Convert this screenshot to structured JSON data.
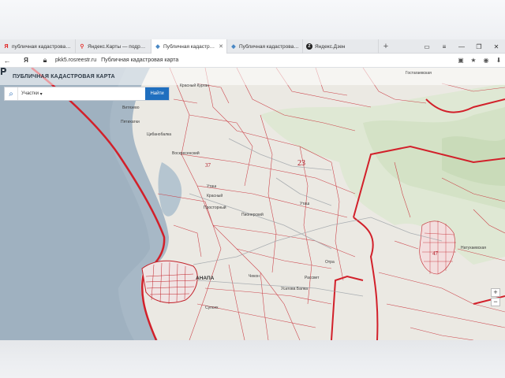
{
  "tabs": [
    {
      "label": "публичная кадастровая ка"
    },
    {
      "label": "Яндекс.Карты — подробн"
    },
    {
      "label": "Публичная кадастровая"
    },
    {
      "label": "Публичная кадастровая ка"
    },
    {
      "label": "Яндекс.Дзен"
    }
  ],
  "address": {
    "domain": "pkk5.rosreestr.ru",
    "title": "Публичная кадастровая карта"
  },
  "app": {
    "title": "ПУБЛИЧНАЯ КАДАСТРОВАЯ КАРТА"
  },
  "search": {
    "type": "Участки",
    "placeholder": "",
    "button": "Найти"
  },
  "places": [
    "Красный Курган",
    "Гостагаевская",
    "Витязево",
    "Цибанобалка",
    "Пятихатки",
    "Воскресенский",
    "Красный",
    "Пионерский",
    "Уташ",
    "Чекон",
    "Рассвет",
    "Отра",
    "Усатова Балка",
    "Супсех",
    "Натухаевская",
    "Уташ",
    "АНАПА",
    "Просторный"
  ],
  "districts": [
    "23",
    "37",
    "47"
  ]
}
